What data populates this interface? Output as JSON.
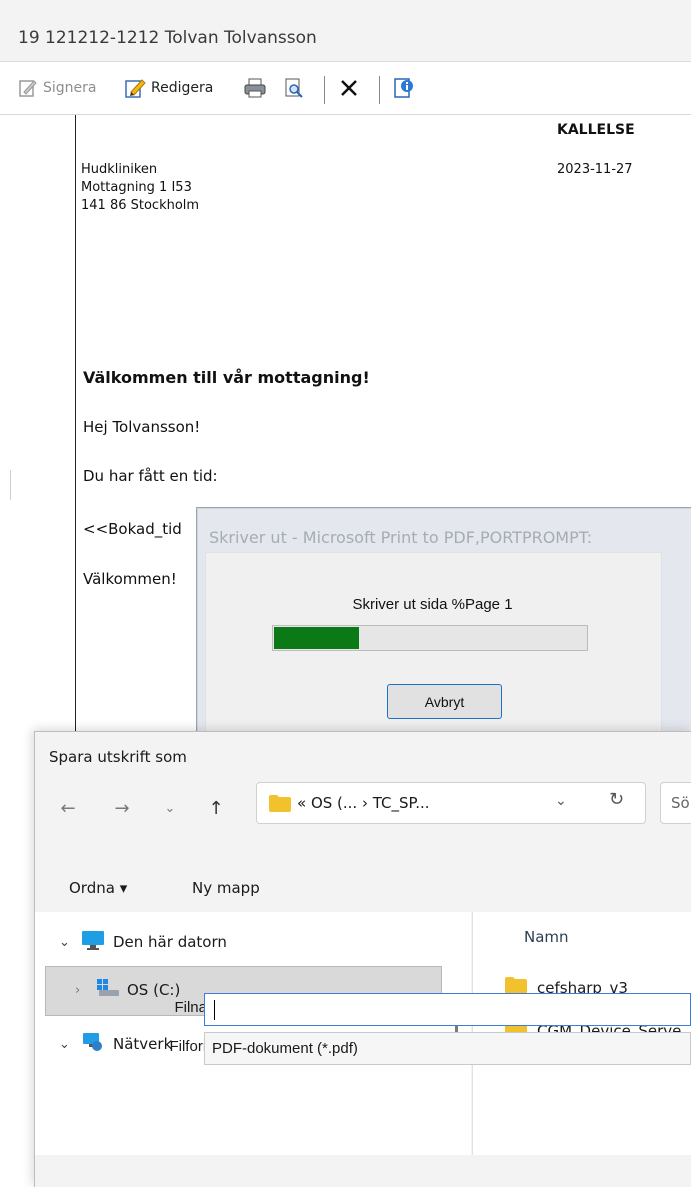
{
  "window": {
    "title": "19 121212-1212 Tolvan Tolvansson"
  },
  "toolbar": {
    "sign_label": "Signera",
    "edit_label": "Redigera"
  },
  "document": {
    "heading_right": "KALLELSE",
    "date": "2023-11-27",
    "address_line1": "Hudkliniken",
    "address_line2": "Mottagning 1 I53",
    "address_line3": "141 86 Stockholm",
    "welcome_heading": "Välkommen till vår mottagning!",
    "greeting": "Hej Tolvansson!",
    "line_time": "Du har fått en tid:",
    "placeholder_text": "<<Bokad_tid",
    "closing": "Välkommen!"
  },
  "print_dialog": {
    "title": "Skriver ut - Microsoft Print to PDF,PORTPROMPT:",
    "message": "Skriver ut sida %Page 1",
    "progress": 0.27,
    "progress_color": "#0b7a16",
    "cancel_label": "Avbryt"
  },
  "save_dialog": {
    "title": "Spara utskrift som",
    "address_path": "« OS (... › TC_SP...",
    "search_placeholder": "Sö",
    "organize_label": "Ordna ▾",
    "new_folder_label": "Ny mapp",
    "tree": [
      {
        "label": "Den här datorn",
        "icon": "computer-icon",
        "expanded": true
      },
      {
        "label": "OS (C:)",
        "icon": "drive-icon",
        "selected": true
      },
      {
        "label": "Nätverk",
        "icon": "network-icon",
        "expanded": true
      }
    ],
    "column_name": "Namn",
    "files": [
      "cefsharp_v3",
      "CGM_Device_Serve"
    ],
    "filename_label": "Filnamn:",
    "filename_value": "",
    "format_label": "Filformat:",
    "format_value": "PDF-dokument (*.pdf)"
  },
  "colors": {
    "accent": "#1e70c8",
    "folder": "#f2c12e"
  }
}
